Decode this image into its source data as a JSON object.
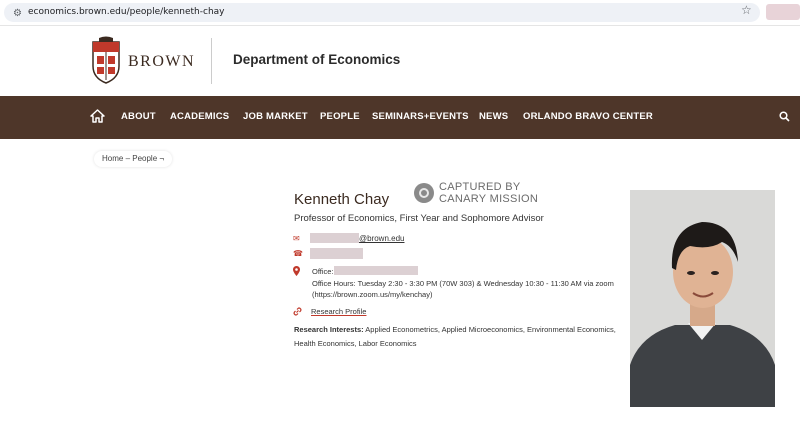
{
  "browser": {
    "url": "economics.brown.edu/people/kenneth-chay"
  },
  "header": {
    "brand_wordmark": "BROWN",
    "department": "Department of Economics"
  },
  "nav": {
    "items": [
      {
        "label": "ABOUT"
      },
      {
        "label": "ACADEMICS"
      },
      {
        "label": "JOB MARKET"
      },
      {
        "label": "PEOPLE"
      },
      {
        "label": "SEMINARS+EVENTS"
      },
      {
        "label": "NEWS"
      },
      {
        "label": "ORLANDO BRAVO CENTER"
      }
    ]
  },
  "breadcrumb": {
    "text": "Home – People ¬"
  },
  "profile": {
    "name": "Kenneth Chay",
    "title": "Professor of Economics, First Year and Sophomore Advisor",
    "email_domain": "@brown.edu",
    "office_label": "Office:",
    "office_hours": "Office Hours: Tuesday 2:30 - 3:30 PM (70W 303) & Wednesday 10:30 - 11:30 AM via zoom (https://brown.zoom.us/my/kenchay)",
    "research_profile_link": "Research Profile",
    "research_interests_label": "Research Interests:",
    "research_interests": "Applied Econometrics, Applied Microeconomics, Environmental Economics, Health Economics, Labor Economics"
  },
  "watermark": {
    "line1": "CAPTURED BY",
    "line2": "CANARY MISSION"
  },
  "colors": {
    "nav_brown": "#4e3629",
    "accent_red": "#c0392b",
    "redaction": "#dcd0d3"
  },
  "icons": {
    "home": "home-icon",
    "search": "search-icon",
    "email": "envelope-icon",
    "phone": "phone-icon",
    "location": "map-pin-icon",
    "link": "link-icon",
    "star": "star-icon"
  }
}
